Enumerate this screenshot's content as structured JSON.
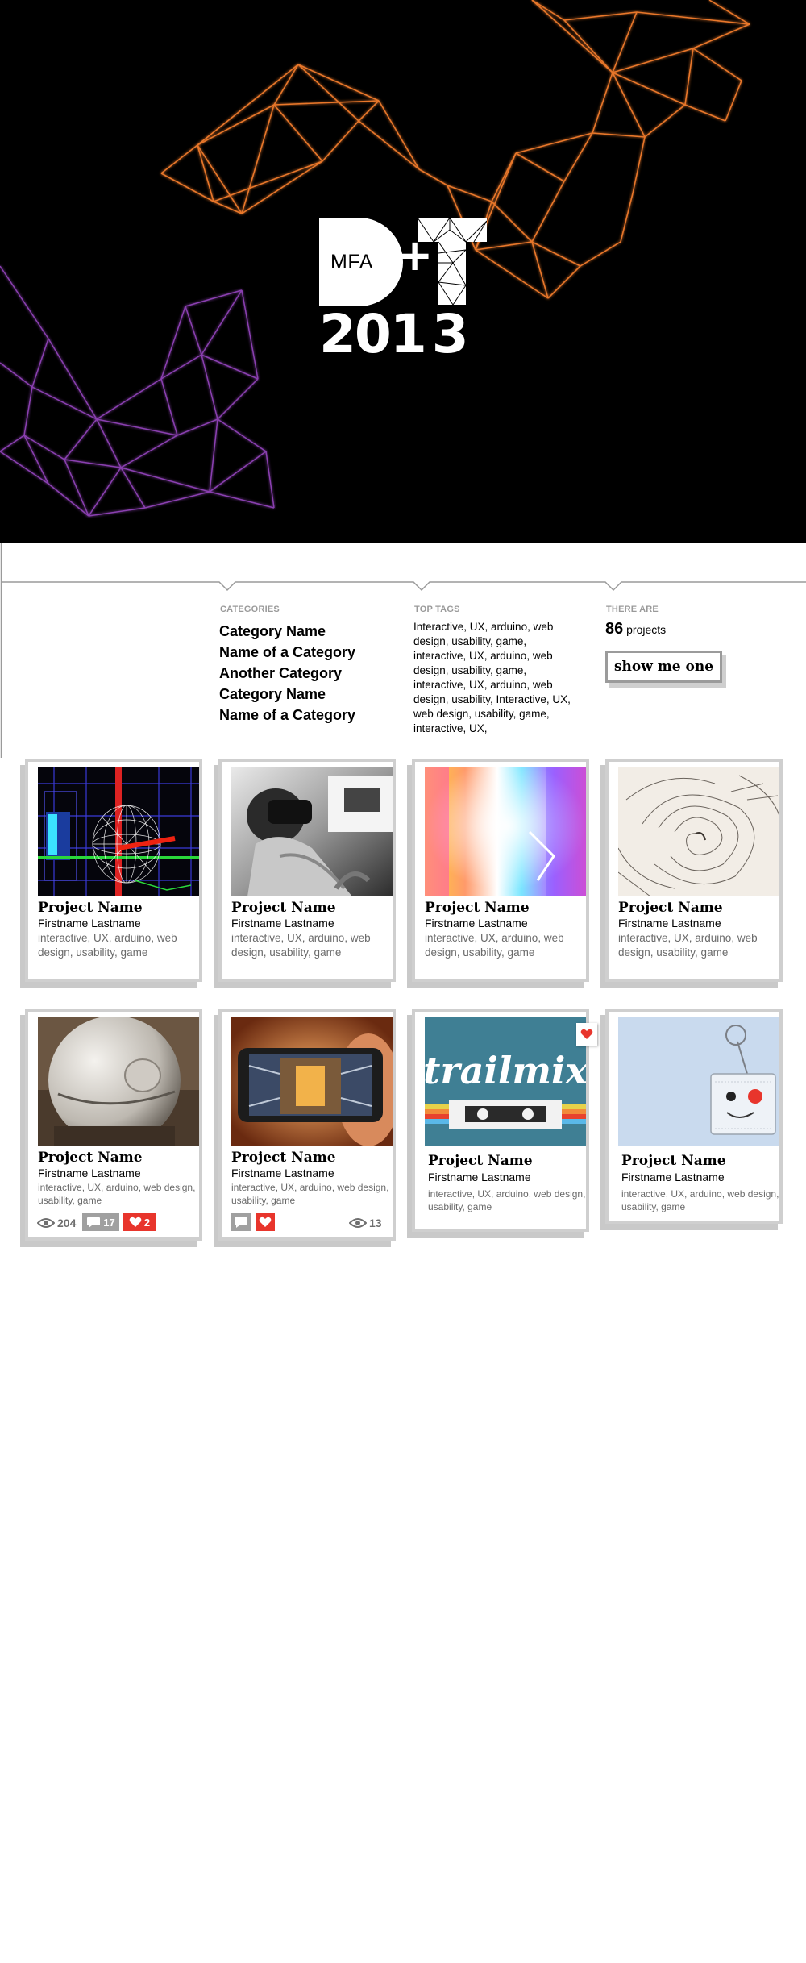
{
  "hero": {
    "logo": {
      "mfa": "MFA",
      "plus": "+",
      "year_a": "201",
      "year_b": "3"
    },
    "mesh_colors": {
      "orange": "#e8772a",
      "purple": "#8a3fb0",
      "deep": "#4a25a6"
    }
  },
  "filters": {
    "categories": {
      "label": "CATEGORIES",
      "items": [
        "Category Name",
        "Name of a Category",
        "Another Category",
        "Category Name",
        "Name of a Category"
      ]
    },
    "top_tags": {
      "label": "TOP TAGS",
      "text": "Interactive, UX, arduino, web design, usability, game, interactive, UX, arduino, web design, usability, game, interactive, UX, arduino, web design, usability, Interactive, UX, web design, usability, game, interactive, UX,"
    },
    "count": {
      "label": "THERE ARE",
      "number": "86",
      "suffix": "projects",
      "button": "show me one"
    }
  },
  "projects": [
    {
      "name": "Project Name",
      "author": "Firstname Lastname",
      "tags": "interactive, UX, arduino, web design, usability, game",
      "image": "wireframe-sphere"
    },
    {
      "name": "Project Name",
      "author": "Firstname Lastname",
      "tags": "interactive, UX, arduino, web design, usability, game",
      "image": "vr-headset-photo"
    },
    {
      "name": "Project Name",
      "author": "Firstname Lastname",
      "tags": "interactive, UX, arduino, web design, usability, game",
      "image": "rainbow-light"
    },
    {
      "name": "Project Name",
      "author": "Firstname Lastname",
      "tags": "interactive, UX, arduino, web design, usability, game",
      "image": "ink-drawing"
    },
    {
      "name": "Project Name",
      "author": "Firstname Lastname",
      "tags": "interactive, UX, arduino, web design, usability, game",
      "image": "white-robot-sphere",
      "stats": {
        "views": "204",
        "comments": "17",
        "likes": "2"
      }
    },
    {
      "name": "Project Name",
      "author": "Firstname Lastname",
      "tags": "interactive, UX, arduino, web design, usability, game",
      "image": "phone-camera",
      "stats": {
        "views": "13"
      }
    },
    {
      "name": "Project Name",
      "author": "Firstname Lastname",
      "tags": "interactive, UX, arduino, web design, usability, game",
      "image": "trailmix-cassette",
      "image_text": "trailmix"
    },
    {
      "name": "Project Name",
      "author": "Firstname Lastname",
      "tags": "interactive, UX, arduino, web design, usability, game",
      "image": "paper-robot"
    }
  ]
}
